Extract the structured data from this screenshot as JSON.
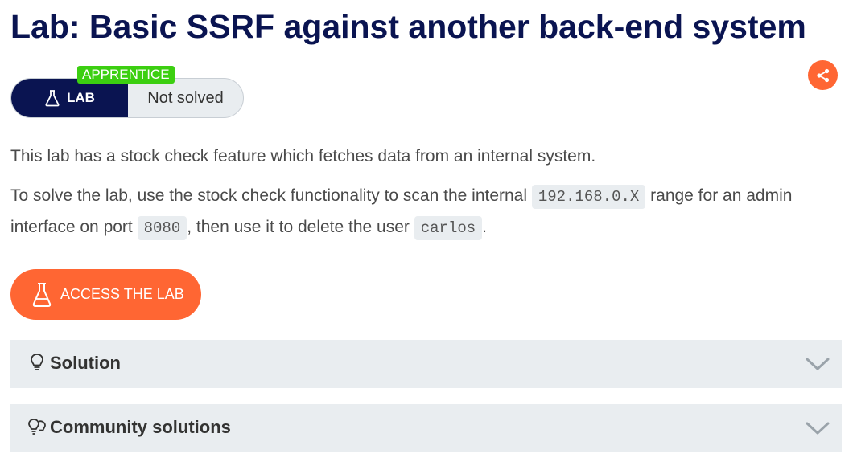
{
  "page": {
    "title": "Lab: Basic SSRF against another back-end system"
  },
  "lab_status": {
    "level": "APPRENTICE",
    "tag": "LAB",
    "status": "Not solved"
  },
  "description": {
    "line1": "This lab has a stock check feature which fetches data from an internal system.",
    "line2_a": "To solve the lab, use the stock check functionality to scan the internal",
    "code_ip": "192.168.0.X",
    "line2_b": "range for an admin interface on port",
    "code_port": "8080",
    "line2_c": ", then use it to delete the user",
    "code_user": "carlos",
    "line2_d": "."
  },
  "access_button": {
    "label": "ACCESS THE LAB"
  },
  "accordions": [
    {
      "label": "Solution",
      "icon": "lightbulb-icon"
    },
    {
      "label": "Community solutions",
      "icon": "lightbulbs-icon"
    }
  ],
  "colors": {
    "title": "#0a1451",
    "accent": "#ff6633",
    "badge": "#3ccf11",
    "panel": "#e9edf0"
  }
}
